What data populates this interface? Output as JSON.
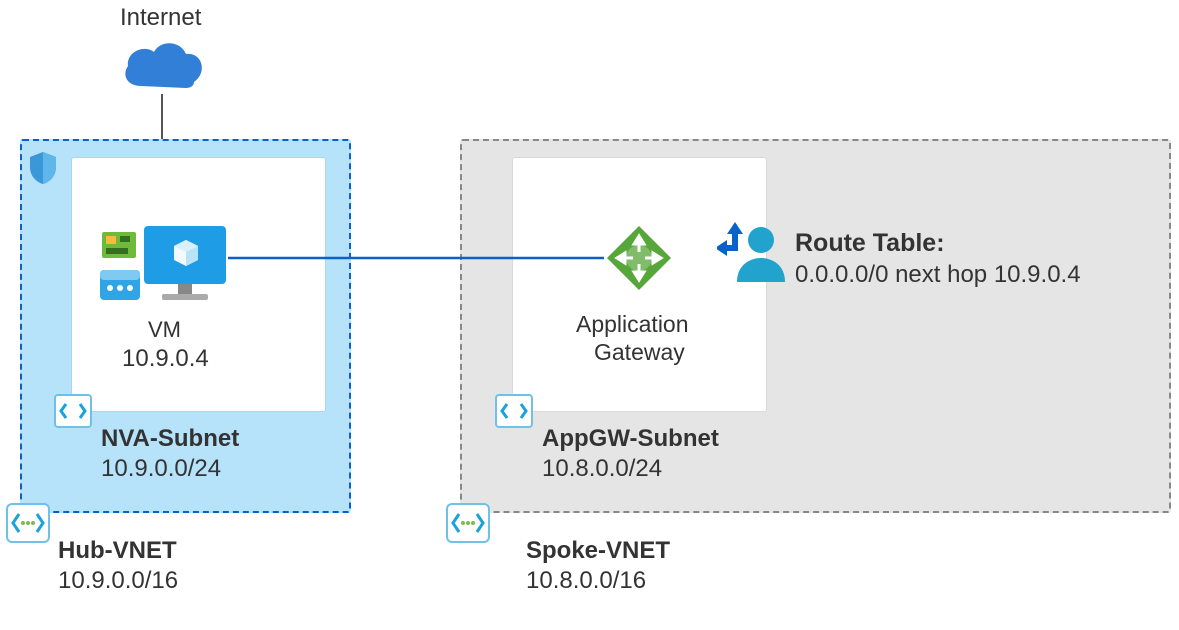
{
  "internet": {
    "label": "Internet"
  },
  "hub": {
    "vnet_name": "Hub-VNET",
    "vnet_cidr": "10.9.0.0/16",
    "subnet_name": "NVA-Subnet",
    "subnet_cidr": "10.9.0.0/24",
    "vm_label": "VM",
    "vm_ip": "10.9.0.4"
  },
  "spoke": {
    "vnet_name": "Spoke-VNET",
    "vnet_cidr": "10.8.0.0/16",
    "subnet_name": "AppGW-Subnet",
    "subnet_cidr": "10.8.0.0/24",
    "appgw_label_1": "Application",
    "appgw_label_2": "Gateway"
  },
  "route_table": {
    "title": "Route Table:",
    "rule": "0.0.0.0/0 next hop 10.9.0.4"
  }
}
